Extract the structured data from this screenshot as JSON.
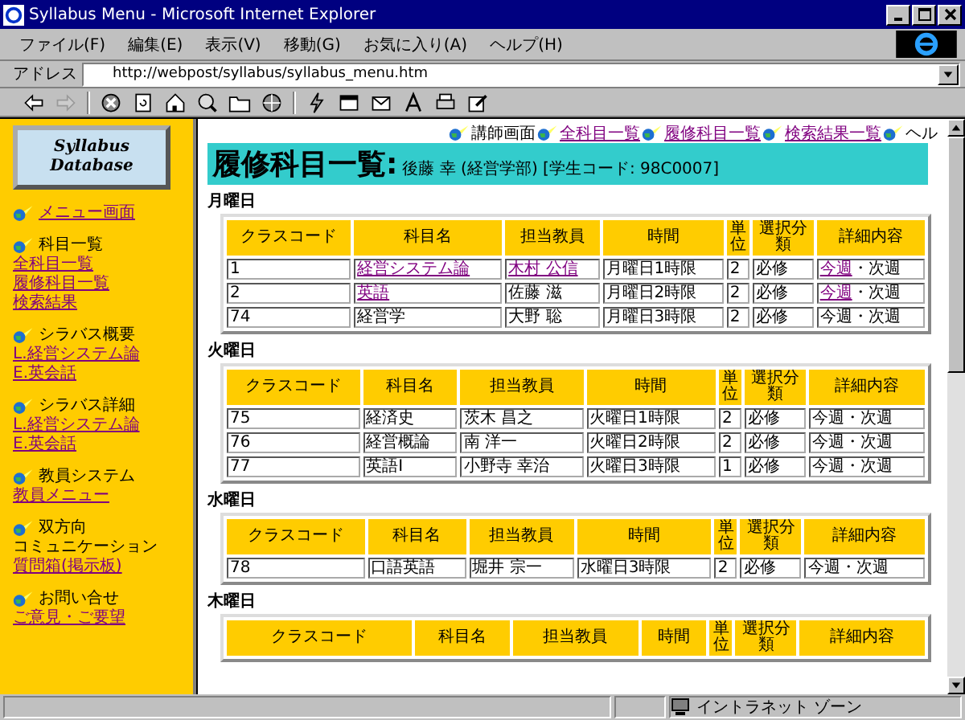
{
  "window": {
    "title": "Syllabus Menu - Microsoft Internet Explorer"
  },
  "menu": [
    "ファイル(F)",
    "編集(E)",
    "表示(V)",
    "移動(G)",
    "お気に入り(A)",
    "ヘルプ(H)"
  ],
  "address": {
    "label": "アドレス",
    "value": "http://webpost/syllabus/syllabus_menu.htm"
  },
  "sidebar": {
    "logo": [
      "Syllabus",
      "Database"
    ],
    "sections": [
      {
        "links": [
          "メニュー画面"
        ]
      },
      {
        "heading": "科目一覧",
        "links": [
          "全科目一覧",
          "履修科目一覧",
          "検索結果"
        ]
      },
      {
        "heading": "シラバス概要",
        "links": [
          "L.経営システム論",
          "E.英会話"
        ]
      },
      {
        "heading": "シラバス詳細",
        "links": [
          "L.経営システム論",
          "E.英会話"
        ]
      },
      {
        "heading": "教員システム",
        "links": [
          "教員メニュー"
        ]
      },
      {
        "heading": "双方向",
        "subheading": "コミュニケーション",
        "links": [
          "質問箱(掲示板)"
        ]
      },
      {
        "heading": "お問い合せ",
        "links": [
          "ご意見・ご要望"
        ]
      }
    ]
  },
  "nav": [
    {
      "label": "講師画面",
      "link": false
    },
    {
      "label": "全科目一覧",
      "link": true
    },
    {
      "label": "履修科目一覧",
      "link": true
    },
    {
      "label": "検索結果一覧",
      "link": true
    },
    {
      "label": "ヘル",
      "link": false
    }
  ],
  "page_title": "履修科目一覧:",
  "student": "後藤 幸 (経営学部) [学生コード: 98C0007]",
  "days": [
    {
      "day": "月曜日",
      "columns": [
        "クラスコード",
        "科目名",
        "担当教員",
        "時間",
        "単位",
        "選択分類",
        "詳細内容"
      ],
      "rows": [
        {
          "code": "1",
          "course": "経営システム論",
          "course_link": true,
          "teacher": "木村 公信",
          "teacher_link": true,
          "time": "月曜日1時限",
          "credits": "2",
          "category": "必修",
          "detail": [
            "今週",
            "・次週"
          ],
          "detail_link": true
        },
        {
          "code": "2",
          "course": "英語",
          "course_link": true,
          "teacher": "佐藤 滋",
          "teacher_link": false,
          "time": "月曜日2時限",
          "credits": "2",
          "category": "必修",
          "detail": [
            "今週",
            "・次週"
          ],
          "detail_link": true
        },
        {
          "code": "74",
          "course": "経営学",
          "course_link": false,
          "teacher": "大野 聡",
          "teacher_link": false,
          "time": "月曜日3時限",
          "credits": "2",
          "category": "必修",
          "detail": [
            "今週",
            "・次週"
          ],
          "detail_link": false
        }
      ]
    },
    {
      "day": "火曜日",
      "columns": [
        "クラスコード",
        "科目名",
        "担当教員",
        "時間",
        "単位",
        "選択分類",
        "詳細内容"
      ],
      "rows": [
        {
          "code": "75",
          "course": "経済史",
          "course_link": false,
          "teacher": "茨木 昌之",
          "teacher_link": false,
          "time": "火曜日1時限",
          "credits": "2",
          "category": "必修",
          "detail": [
            "今週",
            "・次週"
          ],
          "detail_link": false
        },
        {
          "code": "76",
          "course": "経営概論",
          "course_link": false,
          "teacher": "南 洋一",
          "teacher_link": false,
          "time": "火曜日2時限",
          "credits": "2",
          "category": "必修",
          "detail": [
            "今週",
            "・次週"
          ],
          "detail_link": false
        },
        {
          "code": "77",
          "course": "英語Ⅰ",
          "course_link": false,
          "teacher": "小野寺 幸治",
          "teacher_link": false,
          "time": "火曜日3時限",
          "credits": "1",
          "category": "必修",
          "detail": [
            "今週",
            "・次週"
          ],
          "detail_link": false
        }
      ]
    },
    {
      "day": "水曜日",
      "columns": [
        "クラスコード",
        "科目名",
        "担当教員",
        "時間",
        "単位",
        "選択分類",
        "詳細内容"
      ],
      "rows": [
        {
          "code": "78",
          "course": "口語英語",
          "course_link": false,
          "teacher": "堀井 宗一",
          "teacher_link": false,
          "time": "水曜日3時限",
          "credits": "2",
          "category": "必修",
          "detail": [
            "今週",
            "・次週"
          ],
          "detail_link": false
        }
      ]
    },
    {
      "day": "木曜日",
      "columns": [
        "クラスコード",
        "科目名",
        "担当教員",
        "時間",
        "単位",
        "選択分類",
        "詳細内容"
      ]
    }
  ],
  "status_bar": {
    "zone": "イントラネット ゾーン"
  }
}
